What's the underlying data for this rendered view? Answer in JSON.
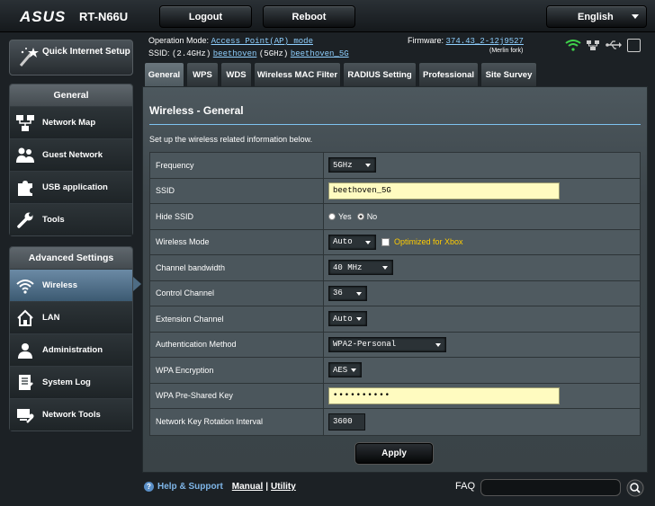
{
  "header": {
    "logo": "ASUS",
    "model": "RT-N66U",
    "logout_label": "Logout",
    "reboot_label": "Reboot",
    "language": "English"
  },
  "info": {
    "operation_mode_label": "Operation Mode:",
    "operation_mode_value": "Access Point(AP) mode",
    "ssid_label": "SSID:",
    "ssid_24_label": "(2.4GHz)",
    "ssid_24_value": "beethoven",
    "ssid_5_label": "(5GHz)",
    "ssid_5_value": "beethoven_5G",
    "firmware_label": "Firmware:",
    "firmware_value": "374.43_2-12j9527",
    "fork_note": "(Merlin fork)"
  },
  "sidebar": {
    "quick_setup": "Quick Internet Setup",
    "general_header": "General",
    "general_items": [
      {
        "label": "Network Map"
      },
      {
        "label": "Guest Network"
      },
      {
        "label": "USB application"
      },
      {
        "label": "Tools"
      }
    ],
    "advanced_header": "Advanced Settings",
    "advanced_items": [
      {
        "label": "Wireless"
      },
      {
        "label": "LAN"
      },
      {
        "label": "Administration"
      },
      {
        "label": "System Log"
      },
      {
        "label": "Network Tools"
      }
    ],
    "active_item": "Wireless"
  },
  "tabs": [
    {
      "label": "General"
    },
    {
      "label": "WPS"
    },
    {
      "label": "WDS"
    },
    {
      "label": "Wireless MAC Filter"
    },
    {
      "label": "RADIUS Setting"
    },
    {
      "label": "Professional"
    },
    {
      "label": "Site Survey"
    }
  ],
  "active_tab": "General",
  "main": {
    "title": "Wireless - General",
    "description": "Set up the wireless related information below.",
    "rows": [
      {
        "label": "Frequency",
        "value": "5GHz"
      },
      {
        "label": "SSID",
        "value": "beethoven_5G"
      },
      {
        "label": "Hide SSID",
        "yes": "Yes",
        "no": "No",
        "selected": "No"
      },
      {
        "label": "Wireless Mode",
        "value": "Auto",
        "checkbox_label": "Optimized for Xbox"
      },
      {
        "label": "Channel bandwidth",
        "value": "40 MHz"
      },
      {
        "label": "Control Channel",
        "value": "36"
      },
      {
        "label": "Extension Channel",
        "value": "Auto"
      },
      {
        "label": "Authentication Method",
        "value": "WPA2-Personal"
      },
      {
        "label": "WPA Encryption",
        "value": "AES"
      },
      {
        "label": "WPA Pre-Shared Key",
        "value": "••••••••••"
      },
      {
        "label": "Network Key Rotation Interval",
        "value": "3600"
      }
    ],
    "apply_label": "Apply"
  },
  "footer": {
    "help_label": "Help & Support",
    "manual_label": "Manual",
    "separator": "|",
    "utility_label": "Utility",
    "faq_label": "FAQ"
  },
  "colors": {
    "accent": "#7dc3f0",
    "input_highlight": "#fffbc0",
    "xbox_label": "#ffcc00",
    "wifi_status": "#3fd14a"
  }
}
